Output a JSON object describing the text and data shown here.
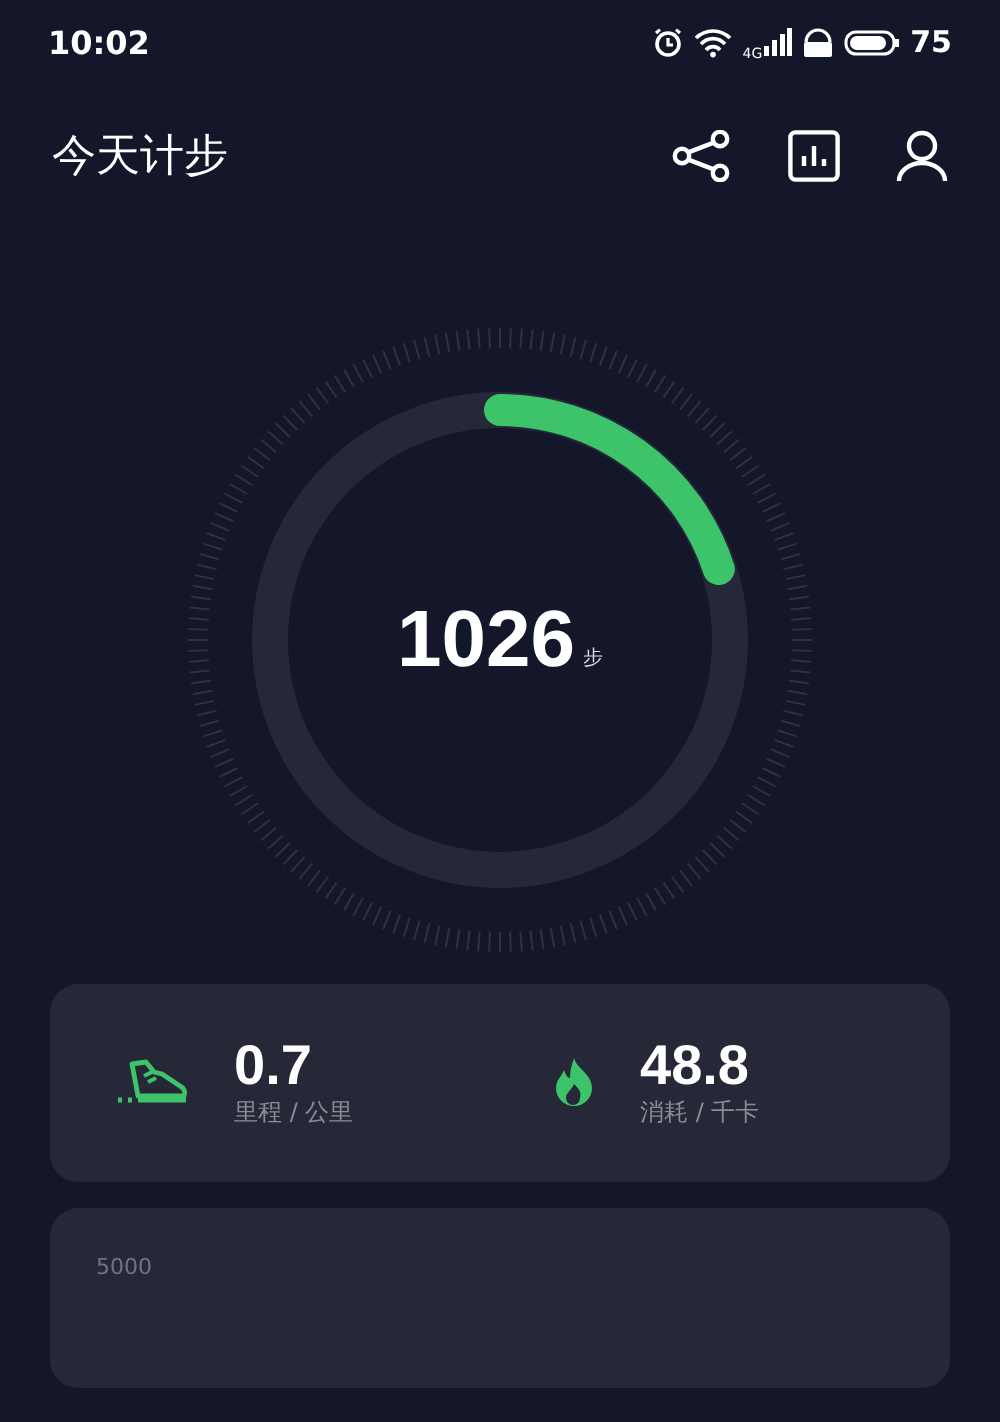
{
  "status_bar": {
    "time": "10:02",
    "network": "4G",
    "battery": "75"
  },
  "header": {
    "title": "今天计步"
  },
  "progress": {
    "steps": "1026",
    "unit": "步",
    "level": 0.2
  },
  "stats": [
    {
      "kind": "distance",
      "value": "0.7",
      "label": "里程 / 公里"
    },
    {
      "kind": "calories",
      "value": "48.8",
      "label": "消耗 / 千卡"
    }
  ],
  "chart_card": {
    "axis_label": "5000"
  }
}
